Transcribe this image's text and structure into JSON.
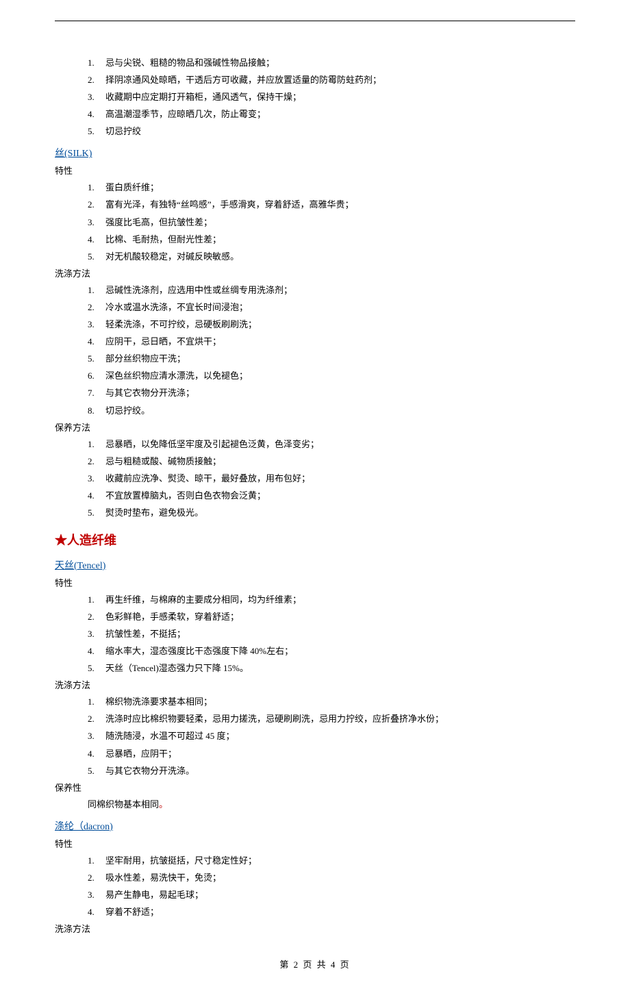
{
  "intro_list": [
    "忌与尖锐、粗糙的物品和强碱性物品接触；",
    "择阴凉通风处晾晒，干透后方可收藏，并应放置适量的防霉防蛀药剂；",
    "收藏期中应定期打开箱柜，通风透气，保持干燥；",
    "高温潮湿季节，应晾晒几次，防止霉变；",
    "切忌拧绞"
  ],
  "silk": {
    "heading": "丝(SILK)",
    "label_properties": "特性",
    "properties": [
      "蛋白质纤维；",
      "富有光泽，有独特“丝鸣感”，手感滑爽，穿着舒适，高雅华贵；",
      "强度比毛高，但抗皱性差；",
      "比棉、毛耐热，但耐光性差；",
      "对无机酸较稳定，对碱反映敏感。"
    ],
    "label_wash": "洗涤方法",
    "wash": [
      "忌碱性洗涤剂，应选用中性或丝绸专用洗涤剂；",
      "冷水或温水洗涤，不宜长时间浸泡；",
      "轻柔洗涤，不可拧绞，忌硬板刷刷洗；",
      "应阴干，忌日晒，不宜烘干；",
      "部分丝织物应干洗；",
      "深色丝织物应清水漂洗，以免褪色；",
      "与其它衣物分开洗涤；",
      "切忌拧绞。"
    ],
    "label_care": "保养方法",
    "care": [
      "忌暴晒，以免降低坚牢度及引起褪色泛黄，色泽变劣；",
      "忌与粗糙或酸、碱物质接触；",
      "收藏前应洗净、熨烫、晾干，最好叠放，用布包好；",
      "不宜放置樟脑丸，否则白色衣物会泛黄；",
      "熨烫时垫布，避免极光。"
    ]
  },
  "manmade": {
    "heading": "★人造纤维"
  },
  "tencel": {
    "heading": "天丝(Tencel)",
    "label_properties": "特性",
    "properties": [
      "再生纤维，与棉麻的主要成分相同，均为纤维素；",
      "色彩鲜艳，手感柔软，穿着舒适；",
      "抗皱性差，不挺括；",
      "缩水率大，湿态强度比干态强度下降 40%左右；",
      "天丝（Tencel)湿态强力只下降 15%。"
    ],
    "label_wash": "洗涤方法",
    "wash": [
      "棉织物洗涤要求基本相同；",
      "洗涤时应比棉织物要轻柔，忌用力搓洗，忌硬刷刷洗，忌用力拧绞，应折叠挤净水份；",
      "随洗随浸，水温不可超过 45 度；",
      "忌暴晒，应阴干；",
      "与其它衣物分开洗涤。"
    ],
    "label_care": "保养性",
    "care_text_prefix": "同棉织物基本相同",
    "care_text_dot": "。"
  },
  "dacron": {
    "heading": "涤纶（dacron)",
    "label_properties": "特性",
    "properties": [
      "坚牢耐用，抗皱挺括，尺寸稳定性好；",
      "吸水性差，易洗快干，免烫；",
      "易产生静电，易起毛球；",
      "穿着不舒适；"
    ],
    "label_wash": "洗涤方法"
  },
  "footer": "第 2 页 共 4 页"
}
